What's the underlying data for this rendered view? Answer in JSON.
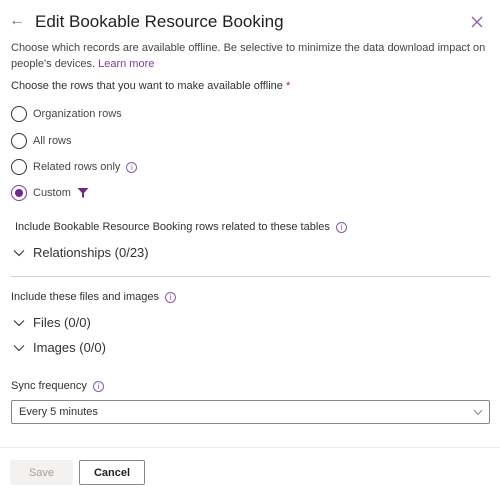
{
  "header": {
    "title": "Edit Bookable Resource Booking",
    "back_icon": "arrow-left-icon",
    "close_icon": "close-icon"
  },
  "description": {
    "text": "Choose which records are available offline. Be selective to minimize the data download impact on people's devices.",
    "link": "Learn more"
  },
  "rows_question": {
    "label": "Choose the rows that you want to make available offline",
    "required_marker": "*",
    "options": [
      {
        "label": "Organization rows",
        "checked": false
      },
      {
        "label": "All rows",
        "checked": false
      },
      {
        "label": "Related rows only",
        "checked": false,
        "info": true
      },
      {
        "label": "Custom",
        "checked": true,
        "filter_icon": true
      }
    ]
  },
  "related_tables": {
    "label": "Include Bookable Resource Booking rows related to these tables",
    "relationships": "Relationships (0/23)"
  },
  "files_images": {
    "label": "Include these files and images",
    "files": "Files (0/0)",
    "images": "Images (0/0)"
  },
  "sync": {
    "label": "Sync frequency",
    "value": "Every 5 minutes"
  },
  "footer": {
    "save_label": "Save",
    "cancel_label": "Cancel"
  },
  "colors": {
    "accent": "#7a3e9d",
    "required": "#a4262c"
  }
}
